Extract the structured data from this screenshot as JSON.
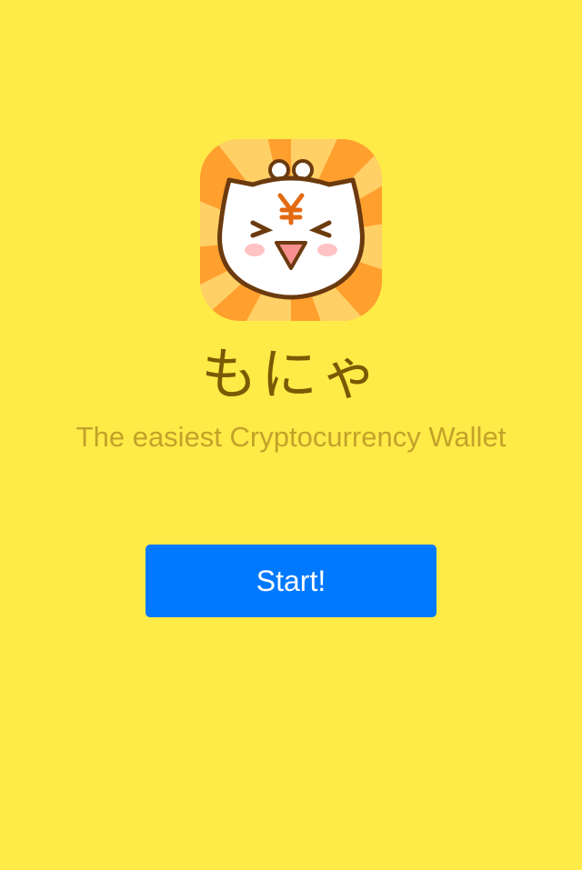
{
  "app": {
    "name": "もにゃ",
    "tagline": "The easiest Cryptocurrency Wallet",
    "icon": "cat-mascot-icon"
  },
  "actions": {
    "start_label": "Start!"
  },
  "colors": {
    "background": "#FFEB47",
    "button": "#0079FF",
    "title": "#7A5A05",
    "tagline": "#C2A22A",
    "icon_rays_dark": "#FF9F2E",
    "icon_rays_light": "#FFD066"
  }
}
